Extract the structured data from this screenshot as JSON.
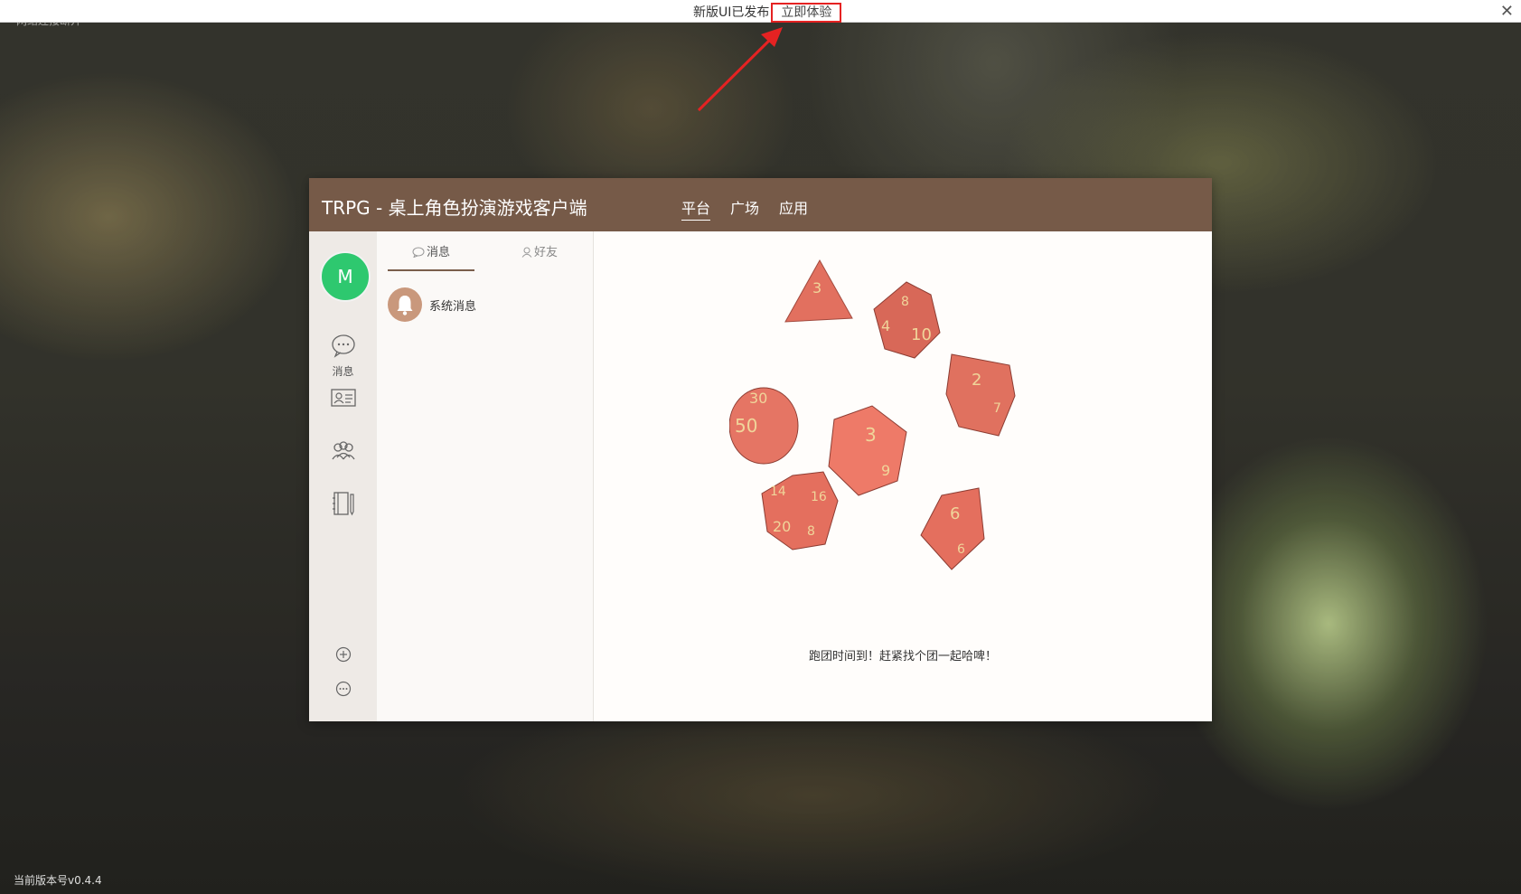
{
  "topbar": {
    "message": "新版UI已发布",
    "action_label": "立即体验",
    "close_glyph": "✕"
  },
  "background": {
    "hint": "网络连接断开"
  },
  "window": {
    "title": "TRPG - 桌上角色扮演游戏客户端",
    "nav": [
      {
        "label": "平台",
        "active": true
      },
      {
        "label": "广场",
        "active": false
      },
      {
        "label": "应用",
        "active": false
      }
    ]
  },
  "sidebar": {
    "avatar_letter": "M",
    "avatar_color": "#2ec86f",
    "items": [
      {
        "icon": "chat-bubble-icon",
        "label": "消息"
      },
      {
        "icon": "contact-card-icon",
        "label": ""
      },
      {
        "icon": "group-icon",
        "label": ""
      },
      {
        "icon": "notebook-icon",
        "label": ""
      },
      {
        "icon": "add-circle-icon",
        "label": ""
      },
      {
        "icon": "more-circle-icon",
        "label": ""
      }
    ]
  },
  "list": {
    "tabs": [
      {
        "label": "消息",
        "icon": "chat-bubble-icon",
        "active": true
      },
      {
        "label": "好友",
        "icon": "user-icon",
        "active": false
      }
    ],
    "items": [
      {
        "name": "系统消息",
        "icon": "bell-icon"
      }
    ]
  },
  "content": {
    "welcome_text": "跑团时间到！赶紧找个团一起哈啤！",
    "dice_numbers": [
      "3",
      "8",
      "4",
      "10",
      "2",
      "7",
      "30",
      "50",
      "3",
      "6",
      "14",
      "16",
      "20",
      "8",
      "6",
      "9"
    ]
  },
  "footer": {
    "version": "当前版本号v0.4.4"
  },
  "colors": {
    "header_brown": "#765a48",
    "annotation_red": "#e52222",
    "dice_red": "#e6705f"
  }
}
